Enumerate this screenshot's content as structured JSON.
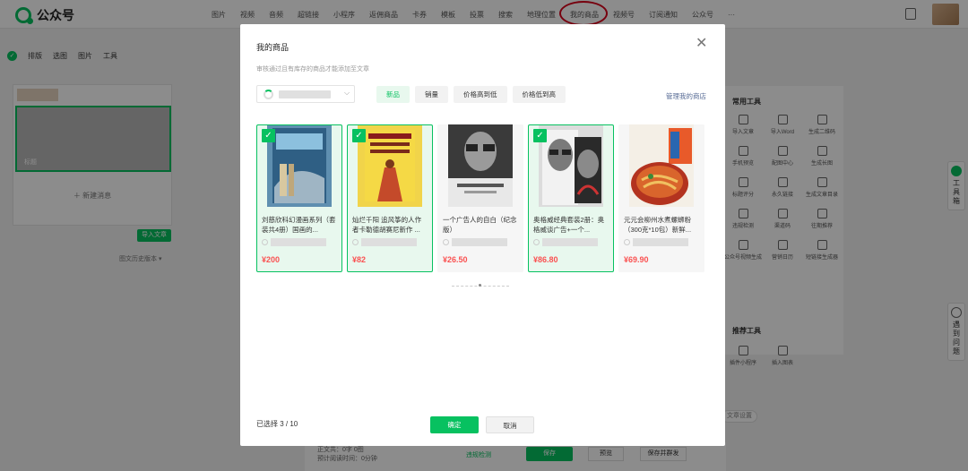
{
  "app": {
    "title": "公众号"
  },
  "menu": {
    "items": [
      "图片",
      "视频",
      "音频",
      "超链接",
      "小程序",
      "返佣商品",
      "卡券",
      "模板",
      "投票",
      "搜索",
      "地理位置",
      "我的商品",
      "视频号",
      "订阅通知",
      "公众号",
      "···"
    ]
  },
  "toolbar2": {
    "items": [
      "排版",
      "选图",
      "图片",
      "工具"
    ]
  },
  "left": {
    "cover_label": "标题",
    "new_message": "＋ 新建消息",
    "import_article": "导入文章",
    "history_version": "图文历史版本 ▾"
  },
  "right": {
    "title": "常用工具",
    "tools": [
      "导入文章",
      "导入Word",
      "生成二维码",
      "手机预览",
      "配图中心",
      "生成长图",
      "标题评分",
      "永久链接",
      "生成文章目录",
      "违规检测",
      "渠道码",
      "往期推荐",
      "公众号视频生成",
      "营销日历",
      "短链接生成器"
    ],
    "title2": "推荐工具",
    "tools2": [
      "插件小程序",
      "插入图表"
    ],
    "article_settings": "文章设置"
  },
  "side_tabs": {
    "toolbox": "工具箱",
    "help": "遇到问题"
  },
  "bottom": {
    "stats_line1": "正文共：0字 0图",
    "stats_line2": "预计阅读时间：0分钟",
    "check": "违规检测",
    "save": "保存",
    "preview": "预览",
    "publish": "保存并群发"
  },
  "modal": {
    "title": "我的商品",
    "subtitle": "审核通过且有库存的商品才能添加至文章",
    "sort_tabs": [
      "新品",
      "销量",
      "价格高到低",
      "价格低到高"
    ],
    "active_sort": "新品",
    "manage_link": "管理我的商店",
    "products": [
      {
        "name": "刘慈欣科幻漫画系列（套装共4册）国画的...",
        "price": "¥200",
        "selected": true
      },
      {
        "name": "灿烂千阳 追风筝的人作者卡勒德胡赛尼新作 ...",
        "price": "¥82",
        "selected": true
      },
      {
        "name": "一个广告人的自白（纪念版）",
        "price": "¥26.50",
        "selected": false
      },
      {
        "name": "奥格威经典套装2册：奥格威谈广告+一个...",
        "price": "¥86.80",
        "selected": true
      },
      {
        "name": "元元会柳州水煮螺蛳粉（300克*10包）新鲜...",
        "price": "¥69.90",
        "selected": false
      }
    ],
    "selected_count": "已选择 3 / 10",
    "confirm": "确定",
    "cancel": "取消"
  },
  "colors": {
    "accent": "#07c160",
    "price": "#fa5151",
    "link": "#576b95",
    "annotation": "#d9001b"
  }
}
